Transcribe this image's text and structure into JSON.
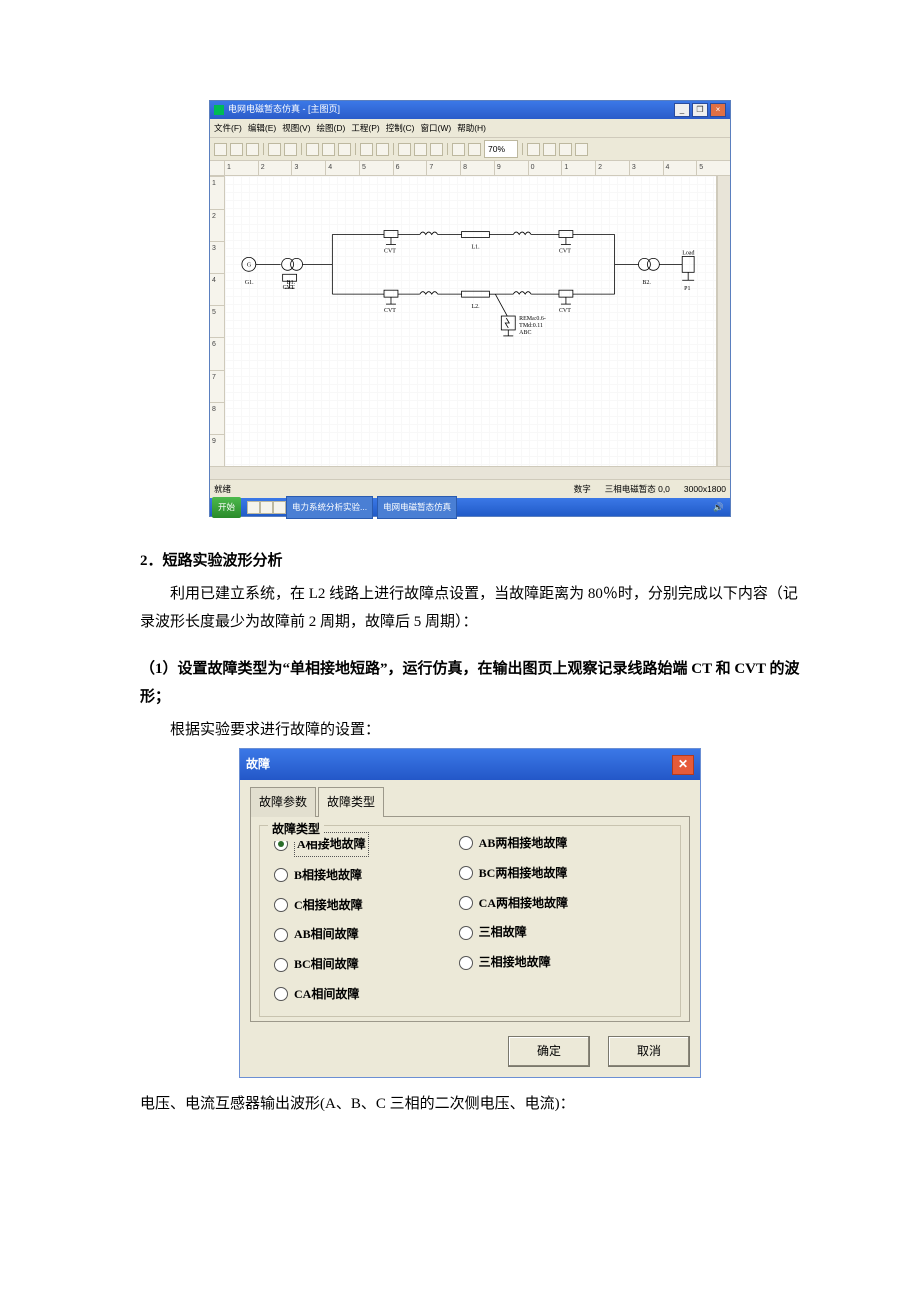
{
  "shot1": {
    "title": "电网电磁暂态仿真 - [主图页]",
    "menus": [
      "文件(F)",
      "编辑(E)",
      "视图(V)",
      "绘图(D)",
      "工程(P)",
      "控制(C)",
      "窗口(W)",
      "帮助(H)"
    ],
    "zoom": "70%",
    "ruler_h": [
      "1",
      "2",
      "3",
      "4",
      "5",
      "6",
      "7",
      "8",
      "9",
      "0",
      "1",
      "2",
      "3",
      "4",
      "5"
    ],
    "ruler_v": [
      "1",
      "2",
      "3",
      "4",
      "5",
      "6",
      "7",
      "8",
      "9"
    ],
    "labels": {
      "g1": "G1.",
      "b1": "B1.",
      "l1": "L1.",
      "l2": "L2.",
      "b2": "B2.",
      "load": "Load",
      "p1": "P1",
      "cvt": "CVT",
      "fault1": "REMa:0.6-",
      "fault2": "TMd:0.11",
      "fault3": "ABC"
    },
    "status": {
      "left": "就绪",
      "num": "数字",
      "mode": "三相电磁暂态 0,0",
      "size": "3000x1800"
    },
    "taskbar": {
      "start": "开始",
      "task1": "电力系统分析实验...",
      "task2": "电网电磁暂态仿真"
    }
  },
  "text": {
    "h1": "2．短路实验波形分析",
    "p1": "利用已建立系统，在 L2 线路上进行故障点设置，当故障距离为 80％时，分别完成以下内容（记录波形长度最少为故障前 2 周期，故障后 5 周期）：",
    "p2": "（1）设置故障类型为“单相接地短路”，运行仿真，在输出图页上观察记录线路始端 CT 和 CVT 的波形；",
    "p3": "根据实验要求进行故障的设置：",
    "p4": "电压、电流互感器输出波形(A、B、C 三相的二次侧电压、电流)："
  },
  "dialog": {
    "title": "故障",
    "tabs": [
      "故障参数",
      "故障类型"
    ],
    "group_title": "故障类型",
    "col1": [
      "A相接地故障",
      "B相接地故障",
      "C相接地故障",
      "AB相间故障",
      "BC相间故障",
      "CA相间故障"
    ],
    "col2": [
      "AB两相接地故障",
      "BC两相接地故障",
      "CA两相接地故障",
      "三相故障",
      "三相接地故障"
    ],
    "selected": "A相接地故障",
    "ok": "确定",
    "cancel": "取消"
  }
}
